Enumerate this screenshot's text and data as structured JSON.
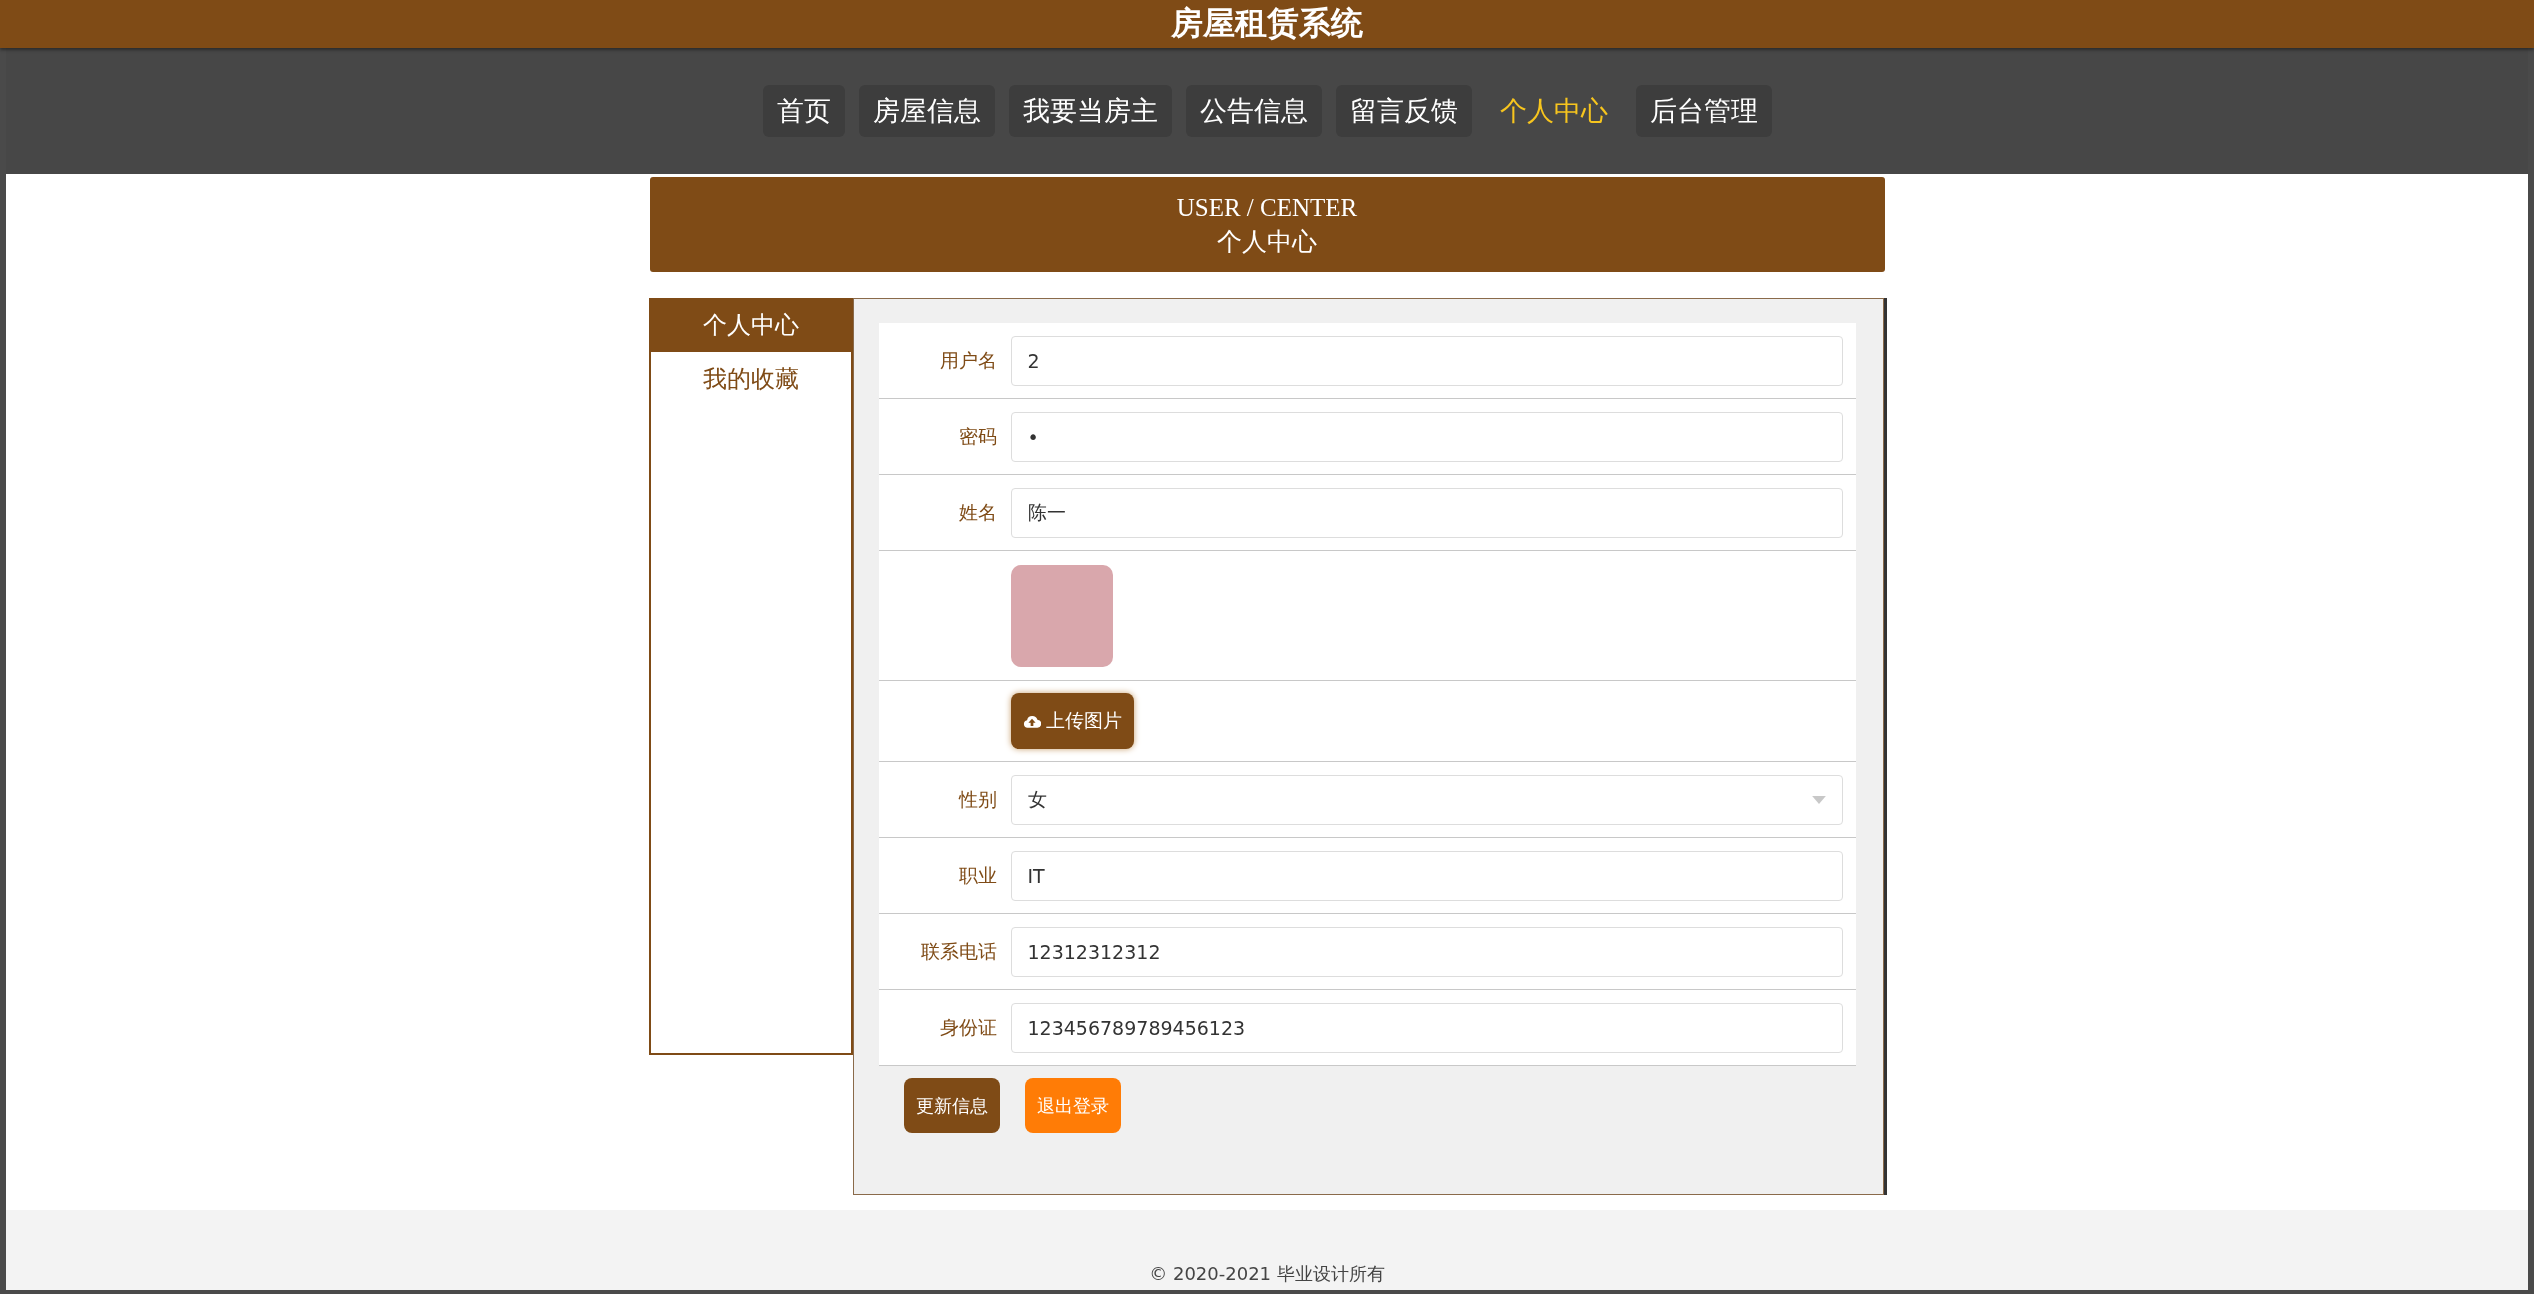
{
  "header": {
    "title": "房屋租赁系统"
  },
  "nav": [
    {
      "label": "首页",
      "selected": false
    },
    {
      "label": "房屋信息",
      "selected": false
    },
    {
      "label": "我要当房主",
      "selected": false
    },
    {
      "label": "公告信息",
      "selected": false
    },
    {
      "label": "留言反馈",
      "selected": false
    },
    {
      "label": "个人中心",
      "selected": true
    },
    {
      "label": "后台管理",
      "selected": false
    }
  ],
  "banner": {
    "title": "USER / CENTER",
    "subtitle": "个人中心"
  },
  "sidebar": {
    "items": [
      {
        "label": "个人中心",
        "selected": true
      },
      {
        "label": "我的收藏",
        "selected": false
      }
    ]
  },
  "form": {
    "fields": [
      {
        "kind": "text",
        "label": "用户名",
        "value": "2"
      },
      {
        "kind": "password",
        "label": "密码",
        "value": "•"
      },
      {
        "kind": "text",
        "label": "姓名",
        "value": "陈一"
      },
      {
        "kind": "image"
      },
      {
        "kind": "upload",
        "button": "上传图片"
      },
      {
        "kind": "select",
        "label": "性别",
        "value": "女"
      },
      {
        "kind": "text",
        "label": "职业",
        "value": "IT"
      },
      {
        "kind": "text",
        "label": "联系电话",
        "value": "12312312312"
      },
      {
        "kind": "text",
        "label": "身份证",
        "value": "123456789789456123"
      }
    ],
    "buttons": [
      {
        "kind": "primary",
        "label": "更新信息"
      },
      {
        "kind": "warning",
        "label": "退出登录"
      }
    ]
  },
  "footer": {
    "text": "© 2020-2021 毕业设计所有"
  }
}
